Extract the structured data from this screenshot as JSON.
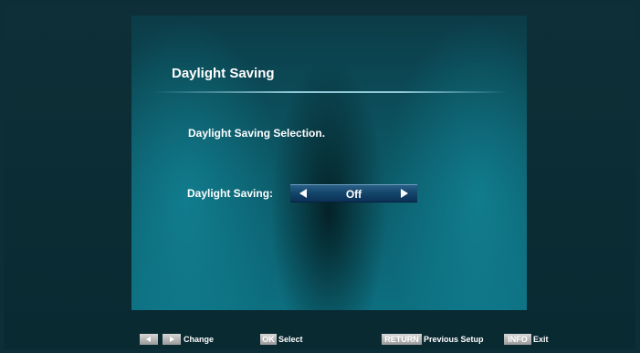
{
  "panel": {
    "title": "Daylight Saving",
    "heading": "Daylight Saving Selection.",
    "setting": {
      "label": "Daylight Saving:",
      "value": "Off"
    }
  },
  "footer": {
    "change_label": "Change",
    "ok_key": "OK",
    "ok_label": "Select",
    "return_key": "RETURN",
    "return_label": "Previous Setup",
    "info_key": "INFO",
    "info_label": "Exit"
  },
  "icons": {
    "left": "arrow-left",
    "right": "arrow-right"
  },
  "colors": {
    "background": "#0c2e36",
    "panel": "#0c5a68",
    "selector": "#13446a",
    "key_badge": "#b0b0b0",
    "text": "#ffffff"
  }
}
